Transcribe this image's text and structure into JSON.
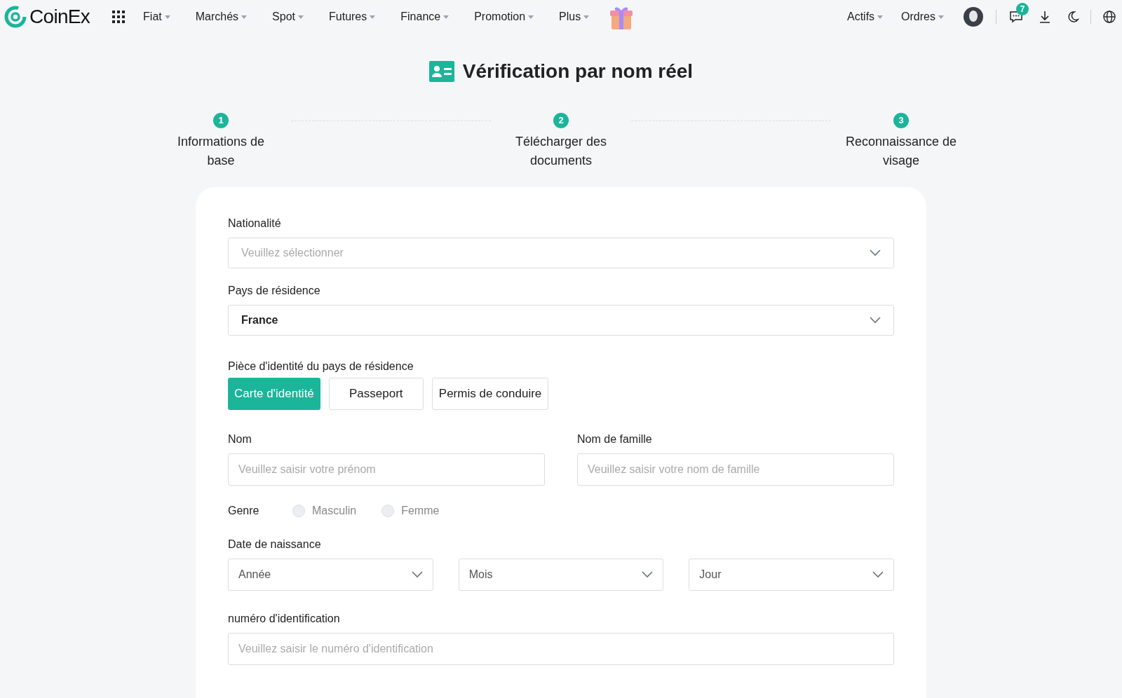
{
  "nav": {
    "logo": "CoinEx",
    "menus": [
      "Fiat",
      "Marchés",
      "Spot",
      "Futures",
      "Finance",
      "Promotion",
      "Plus"
    ],
    "right_menus": [
      "Actifs",
      "Ordres"
    ],
    "message_badge": "7"
  },
  "title": "Vérification par nom réel",
  "steps": [
    {
      "number": "1",
      "label": "Informations de base"
    },
    {
      "number": "2",
      "label": "Télécharger des documents"
    },
    {
      "number": "3",
      "label": "Reconnaissance de visage"
    }
  ],
  "form": {
    "nationality": {
      "label": "Nationalité",
      "placeholder": "Veuillez sélectionner"
    },
    "residence": {
      "label": "Pays de résidence",
      "value": "France"
    },
    "id_type": {
      "label": "Pièce d'identité du pays de résidence",
      "options": [
        {
          "label": "Carte d'identité",
          "selected": true
        },
        {
          "label": "Passeport",
          "selected": false
        },
        {
          "label": "Permis de conduire",
          "selected": false
        }
      ]
    },
    "first_name": {
      "label": "Nom",
      "placeholder": "Veuillez saisir votre prénom"
    },
    "last_name": {
      "label": "Nom de famille",
      "placeholder": "Veuillez saisir votre nom de famille"
    },
    "gender": {
      "label": "Genre",
      "options": [
        {
          "label": "Masculin",
          "selected": false
        },
        {
          "label": "Femme",
          "selected": false
        }
      ]
    },
    "birth_date": {
      "label": "Date de naissance",
      "selects": [
        "Année",
        "Mois",
        "Jour"
      ]
    },
    "id_number": {
      "label": "numéro d'identification",
      "placeholder": "Veuillez saisir le numéro d'identification"
    }
  }
}
